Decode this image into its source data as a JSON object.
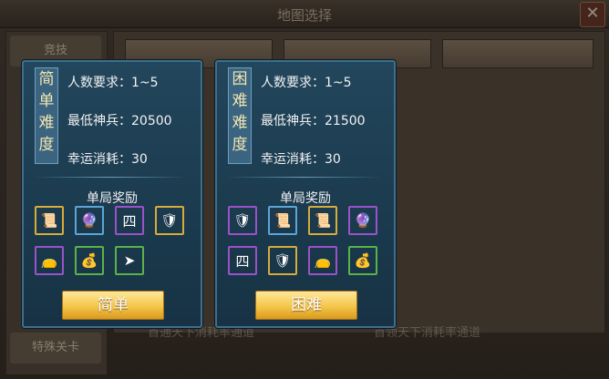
{
  "window": {
    "title": "地图选择",
    "close_glyph": "✕"
  },
  "sidebar": {
    "tabs": [
      {
        "label": "竞技"
      },
      {
        "label": "特殊关卡"
      }
    ]
  },
  "footer": {
    "left_text": "首通天下消耗率通道",
    "right_text": "首领天下消耗率通道"
  },
  "panels": [
    {
      "difficulty_tag": [
        "简",
        "单",
        "难",
        "度"
      ],
      "players_label": "人数要求：1~5",
      "min_power_label": "最低神兵：20500",
      "luck_cost_label": "幸运消耗：30",
      "reward_title": "单局奖励",
      "button_label": "简单",
      "rewards": [
        {
          "icon": "scroll-icon",
          "rarity": "gold",
          "glyph": "📜"
        },
        {
          "icon": "crystal-orb-icon",
          "rarity": "blue",
          "glyph": "🔮"
        },
        {
          "icon": "rune-stone-icon",
          "rarity": "purple",
          "glyph": "四"
        },
        {
          "icon": "hero-portrait-icon",
          "rarity": "gold",
          "glyph": "🛡"
        },
        {
          "icon": "pink-bag-icon",
          "rarity": "purple",
          "glyph": "👝"
        },
        {
          "icon": "green-bag-icon",
          "rarity": "green",
          "glyph": "💰"
        },
        {
          "icon": "arrow-shard-icon",
          "rarity": "green",
          "glyph": "➤"
        }
      ]
    },
    {
      "difficulty_tag": [
        "困",
        "难",
        "难",
        "度"
      ],
      "players_label": "人数要求：1~5",
      "min_power_label": "最低神兵：21500",
      "luck_cost_label": "幸运消耗：30",
      "reward_title": "单局奖励",
      "button_label": "困难",
      "rewards": [
        {
          "icon": "hero-portrait-icon",
          "rarity": "purple",
          "glyph": "🛡"
        },
        {
          "icon": "scroll-stack-icon",
          "rarity": "blue",
          "glyph": "📜"
        },
        {
          "icon": "scroll-icon",
          "rarity": "gold",
          "glyph": "📜"
        },
        {
          "icon": "crystal-orb-icon",
          "rarity": "purple",
          "glyph": "🔮"
        },
        {
          "icon": "rune-stone-icon",
          "rarity": "purple",
          "glyph": "四"
        },
        {
          "icon": "hero-portrait-icon",
          "rarity": "gold",
          "glyph": "🛡"
        },
        {
          "icon": "pink-bag-icon",
          "rarity": "purple",
          "glyph": "👝"
        },
        {
          "icon": "green-bag-icon",
          "rarity": "green",
          "glyph": "💰"
        }
      ]
    }
  ]
}
